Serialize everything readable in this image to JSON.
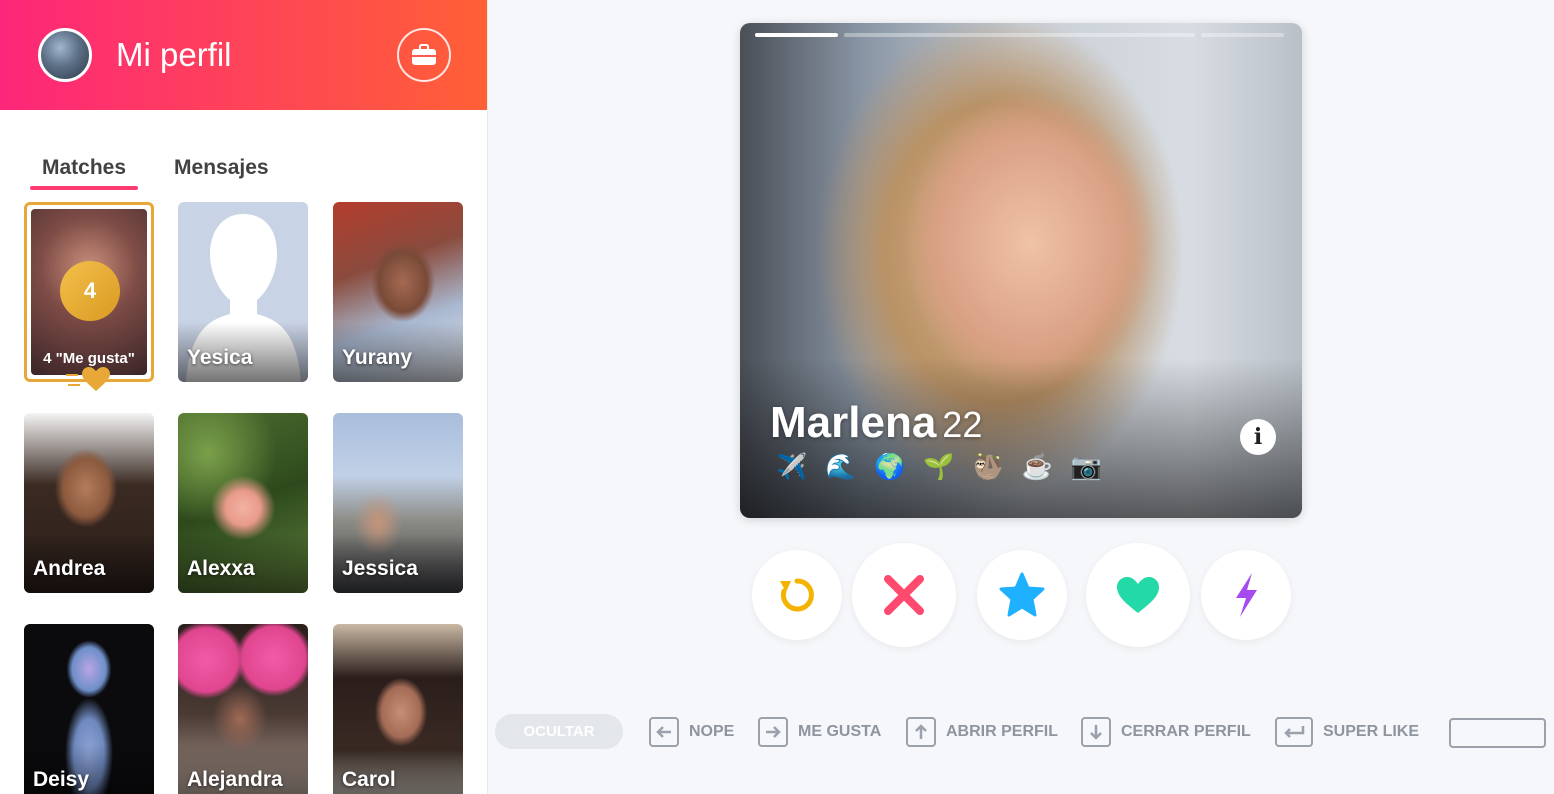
{
  "header": {
    "title": "Mi perfil"
  },
  "tabs": [
    {
      "label": "Matches",
      "active": true
    },
    {
      "label": "Mensajes",
      "active": false
    }
  ],
  "likes_card": {
    "count": "4",
    "label": "4 \"Me gusta\""
  },
  "matches": [
    {
      "name": "Yesica"
    },
    {
      "name": "Yurany"
    },
    {
      "name": "Andrea"
    },
    {
      "name": "Alexxa"
    },
    {
      "name": "Jessica"
    },
    {
      "name": "Deisy"
    },
    {
      "name": "Alejandra"
    },
    {
      "name": "Carol"
    }
  ],
  "profile": {
    "name": "Marlena",
    "age": "22",
    "interests": [
      "✈️",
      "🌊",
      "🌍",
      "🌱",
      "🦥",
      "☕",
      "📷"
    ],
    "photo_index": 1,
    "photo_count": 4
  },
  "actions": {
    "rewind_icon": "rewind-icon",
    "nope_icon": "x-icon",
    "superlike_icon": "star-icon",
    "like_icon": "heart-icon",
    "boost_icon": "bolt-icon",
    "colors": {
      "rewind": "#f5b301",
      "nope": "#fd4a6e",
      "superlike": "#1fb1ff",
      "like": "#24d9a8",
      "boost": "#a54bf0"
    }
  },
  "shortcuts": {
    "hide": "OCULTAR",
    "nope": "NOPE",
    "like": "ME GUSTA",
    "open": "ABRIR PERFIL",
    "close": "CERRAR PERFIL",
    "superlike": "SUPER LIKE"
  },
  "colors": {
    "brand_start": "#fd267a",
    "brand_end": "#ff6036",
    "gold": "#e8a838"
  }
}
